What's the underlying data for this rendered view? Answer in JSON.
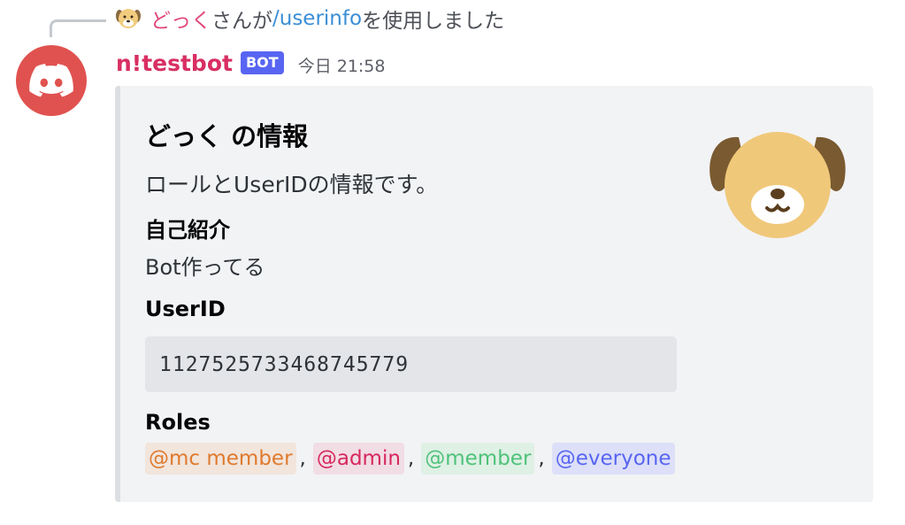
{
  "reply": {
    "user": "どっく",
    "middle": "さんが",
    "command": "/userinfo",
    "suffix": "を使用しました"
  },
  "message": {
    "author": "n!testbot",
    "bot_tag": "BOT",
    "timestamp": "今日 21:58"
  },
  "embed": {
    "title": "どっく の情報",
    "description": "ロールとUserIDの情報です。",
    "fields": [
      {
        "name": "自己紹介",
        "value": "Bot作ってる"
      },
      {
        "name": "UserID",
        "value": "1127525733468745779"
      },
      {
        "name": "Roles"
      }
    ],
    "roles": [
      {
        "label": "@mc member",
        "color": "#e07a2e",
        "bg": "#f1e5dc"
      },
      {
        "label": "@admin",
        "color": "#d6285e",
        "bg": "#f1dde4"
      },
      {
        "label": "@member",
        "color": "#4fc27a",
        "bg": "#dff0e5"
      },
      {
        "label": "@everyone",
        "color": "#5865f2",
        "bg": "#dde0f8"
      }
    ],
    "role_separator": ","
  },
  "colors": {
    "author": "#d82f63",
    "bot_tag_bg": "#5865f2",
    "avatar_bg": "#e0524f",
    "embed_bg": "#f2f3f5",
    "command_link": "#3b8ed6"
  },
  "icons": {
    "avatar": "discord-logo-icon",
    "thumbnail": "dog-face-icon",
    "mini_avatar": "dog-face-icon"
  }
}
